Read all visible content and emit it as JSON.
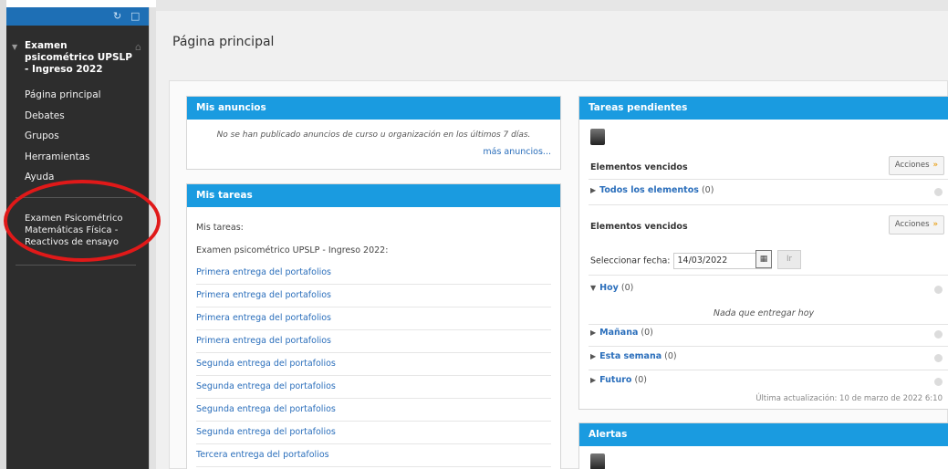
{
  "sidebar": {
    "course_title": "Examen psicométrico UPSLP - Ingreso 2022",
    "nav_items": [
      {
        "label": "Página principal"
      },
      {
        "label": "Debates"
      },
      {
        "label": "Grupos"
      },
      {
        "label": "Herramientas"
      },
      {
        "label": "Ayuda"
      }
    ],
    "test_link": "Examen Psicométrico Matemáticas Física - Reactivos de ensayo"
  },
  "page": {
    "title": "Página principal"
  },
  "anuncios": {
    "header": "Mis anuncios",
    "message": "No se han publicado anuncios de curso u organización en los últimos 7 días.",
    "more_link": "más anuncios..."
  },
  "tareas": {
    "header": "Mis tareas",
    "label": "Mis tareas:",
    "course": "Examen psicométrico UPSLP - Ingreso 2022:",
    "items": [
      "Primera entrega del portafolios",
      "Primera entrega del portafolios",
      "Primera entrega del portafolios",
      "Primera entrega del portafolios",
      "Segunda entrega del portafolios",
      "Segunda entrega del portafolios",
      "Segunda entrega del portafolios",
      "Segunda entrega del portafolios",
      "Tercera entrega del portafolios"
    ]
  },
  "pendientes": {
    "header": "Tareas pendientes",
    "overdue_label": "Elementos vencidos",
    "actions_label": "Acciones",
    "all_items": {
      "name": "Todos los elementos",
      "count": "(0)"
    },
    "due_label": "Elementos vencidos",
    "date_label": "Seleccionar fecha:",
    "date_value": "14/03/2022",
    "go_label": "Ir",
    "today": {
      "name": "Hoy",
      "count": "(0)"
    },
    "nothing_today": "Nada que entregar hoy",
    "tomorrow": {
      "name": "Mañana",
      "count": "(0)"
    },
    "this_week": {
      "name": "Esta semana",
      "count": "(0)"
    },
    "future": {
      "name": "Futuro",
      "count": "(0)"
    },
    "updated": "Última actualización: 10 de marzo de 2022 6:10"
  },
  "alertas": {
    "header": "Alertas"
  },
  "colors": {
    "accent": "#1a9be0",
    "sidebar_bg": "#2d2d2d",
    "link": "#2a6ebb",
    "annotation": "#e01919"
  }
}
